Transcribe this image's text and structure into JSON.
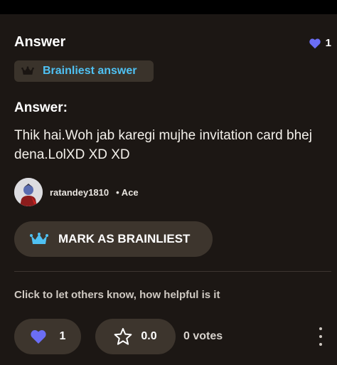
{
  "answer_header": {
    "title": "Answer",
    "likes_count": "1"
  },
  "badge": {
    "label": "Brainliest answer"
  },
  "content": {
    "subtitle": "Answer:",
    "body": "Thik hai.Woh jab karegi mujhe invitation card bhej dena.LolXD XD XD"
  },
  "author": {
    "username": "ratandey1810",
    "rank": "• Ace"
  },
  "actions": {
    "mark_brainliest_label": "MARK AS BRAINLIEST",
    "helpful_prompt": "Click to let others know, how helpful is it",
    "thanks_count": "1",
    "rating_value": "0.0",
    "votes_label": "0 votes"
  },
  "colors": {
    "background": "#1c1714",
    "button_bg": "#3d352d",
    "accent_blue": "#4fc1f3",
    "heart_purple": "#6b6ef5"
  },
  "icons": [
    "heart-icon",
    "crown-icon",
    "star-icon",
    "more-options-icon"
  ]
}
